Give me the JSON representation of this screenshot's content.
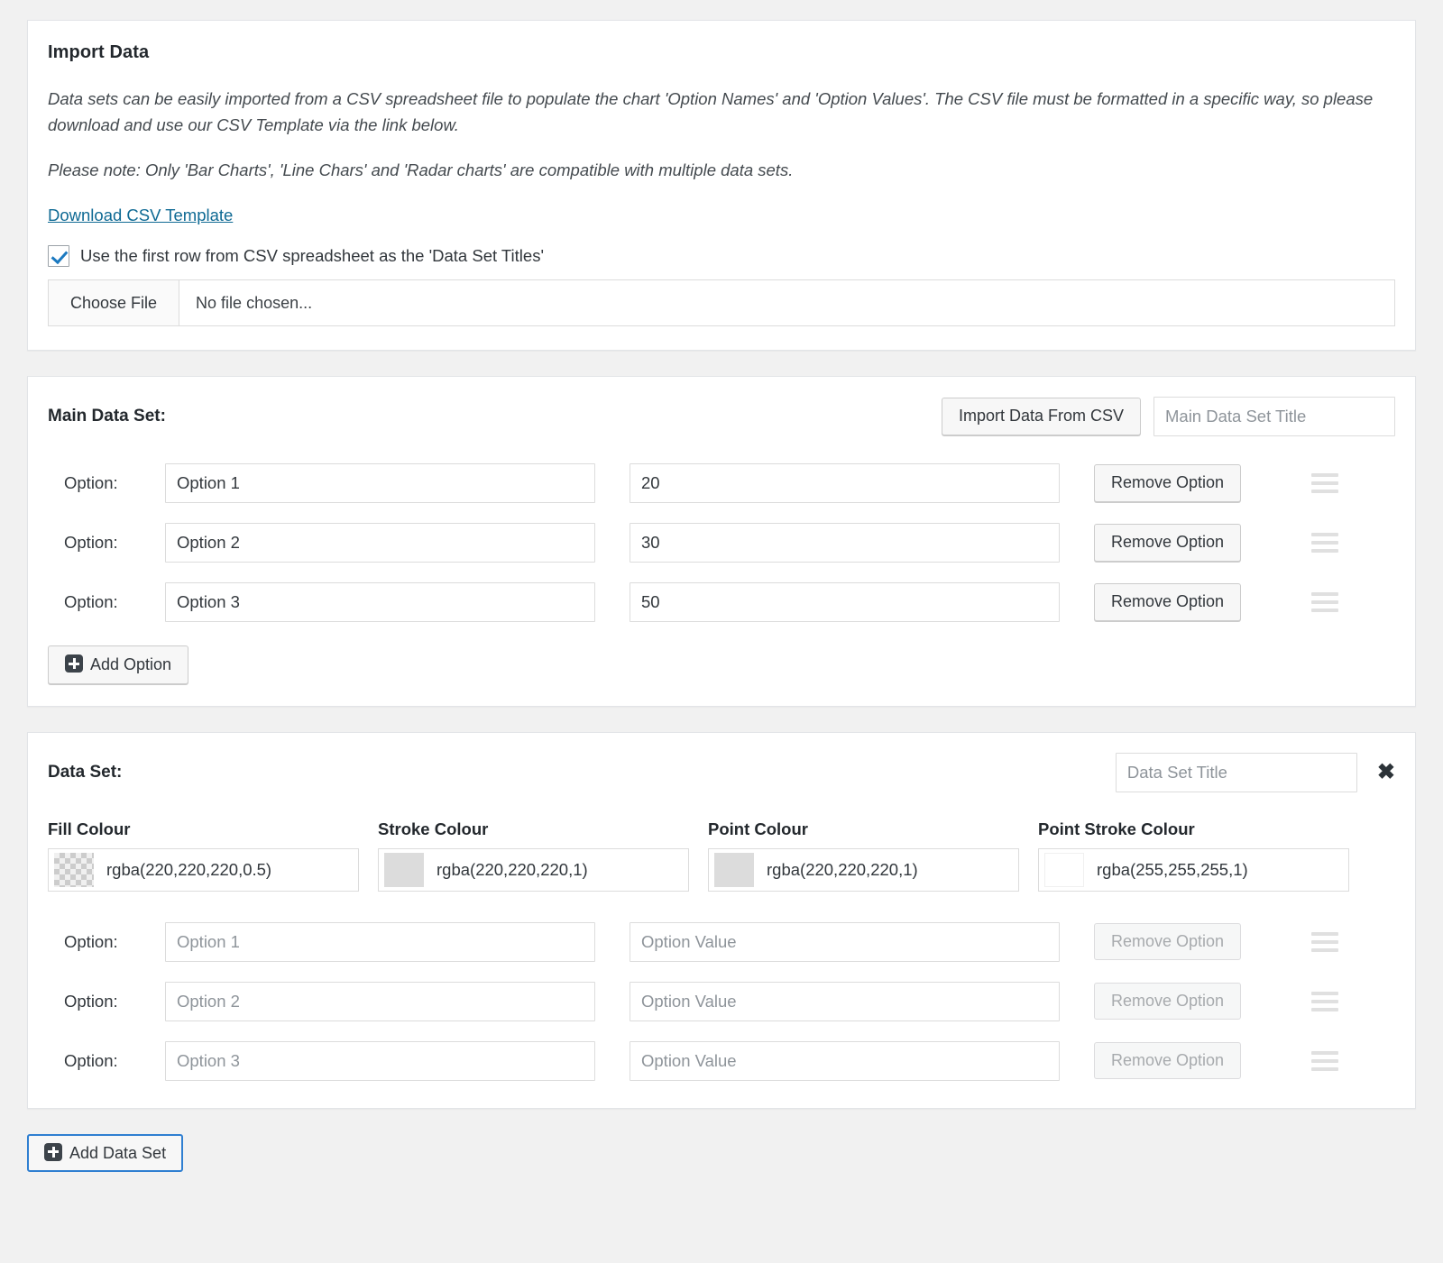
{
  "import_panel": {
    "title": "Import Data",
    "paragraph_1": "Data sets can be easily imported from a CSV spreadsheet file to populate the chart 'Option Names' and 'Option Values'. The CSV file must be formatted in a specific way, so please download and use our CSV Template via the link below.",
    "paragraph_2": "Please note: Only 'Bar Charts', 'Line Chars' and 'Radar charts' are compatible with multiple data sets.",
    "download_link": "Download CSV Template",
    "checkbox_label": "Use the first row from CSV spreadsheet as the 'Data Set Titles'",
    "checkbox_checked": true,
    "file_button_label": "Choose File",
    "file_status": "No file chosen...",
    "link_colour": "#0f6a94",
    "checkbox_colour": "#1b79c0"
  },
  "main_data_set": {
    "title": "Main Data Set:",
    "import_button": "Import Data From CSV",
    "title_placeholder": "Main Data Set Title",
    "title_value": "",
    "option_label": "Option:",
    "remove_label": "Remove Option",
    "add_option_label": "Add Option",
    "rows": [
      {
        "name": "Option 1",
        "value": "20"
      },
      {
        "name": "Option 2",
        "value": "30"
      },
      {
        "name": "Option 3",
        "value": "50"
      }
    ]
  },
  "data_set": {
    "title": "Data Set:",
    "title_placeholder": "Data Set Title",
    "title_value": "",
    "close_label": "✖",
    "option_label": "Option:",
    "remove_label": "Remove Option",
    "value_placeholder": "Option Value",
    "colours": [
      {
        "label": "Fill Colour",
        "value": "rgba(220,220,220,0.5)",
        "swatch": "checker"
      },
      {
        "label": "Stroke Colour",
        "value": "rgba(220,220,220,1)",
        "swatch": "solid-dc"
      },
      {
        "label": "Point Colour",
        "value": "rgba(220,220,220,1)",
        "swatch": "solid-dc"
      },
      {
        "label": "Point Stroke Colour",
        "value": "rgba(255,255,255,1)",
        "swatch": "solid-ff"
      }
    ],
    "rows": [
      {
        "name_placeholder": "Option 1",
        "name_value": "",
        "value": ""
      },
      {
        "name_placeholder": "Option 2",
        "name_value": "",
        "value": ""
      },
      {
        "name_placeholder": "Option 3",
        "name_value": "",
        "value": ""
      }
    ]
  },
  "footer": {
    "add_data_set_label": "Add Data Set"
  }
}
